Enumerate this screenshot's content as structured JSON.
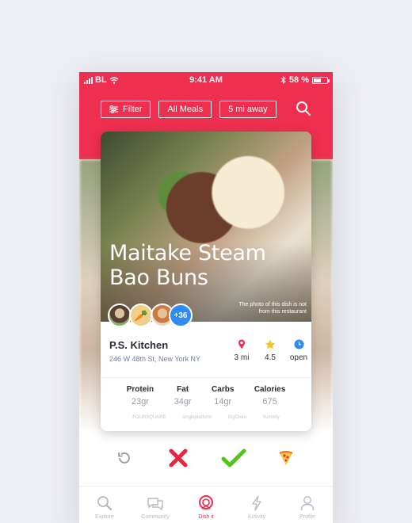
{
  "statusbar": {
    "carrier": "BL",
    "time": "9:41 AM",
    "battery": "58 %",
    "battery_level": 0.58
  },
  "filters": [
    {
      "label": "Filter"
    },
    {
      "label": "All Meals"
    },
    {
      "label": "5 mi away"
    }
  ],
  "card": {
    "title": "Maitake Steam Bao Buns",
    "photo_note": "The photo of this dish is not from this restaurant",
    "more_count": "+36",
    "restaurant_name": "P.S. Kitchen",
    "restaurant_address": "246 W 48th St, New York NY",
    "stats": [
      {
        "icon": "location-pin-icon",
        "value": "3 mi"
      },
      {
        "icon": "star-icon",
        "value": "4.5"
      },
      {
        "icon": "clock-icon",
        "value": "open"
      }
    ],
    "nutrients": [
      {
        "label": "Protein",
        "value": "23gr"
      },
      {
        "label": "Fat",
        "value": "34gr"
      },
      {
        "label": "Carbs",
        "value": "14gr"
      },
      {
        "label": "Calories",
        "value": "675"
      }
    ],
    "sources": [
      "FOURSQUARE",
      "singleplatform",
      "BigOven",
      "Yummly"
    ]
  },
  "tabs": [
    {
      "label": "Explore",
      "icon": "search-icon"
    },
    {
      "label": "Community",
      "icon": "chat-icon"
    },
    {
      "label": "Dish it",
      "icon": "dish-it-icon",
      "active": true
    },
    {
      "label": "Activity",
      "icon": "lightning-icon"
    },
    {
      "label": "Profile",
      "icon": "person-icon"
    }
  ],
  "colors": {
    "accent": "#ee2f4f",
    "reject": "#e8253f",
    "accept": "#52c41a",
    "info": "#2f8cf2"
  }
}
